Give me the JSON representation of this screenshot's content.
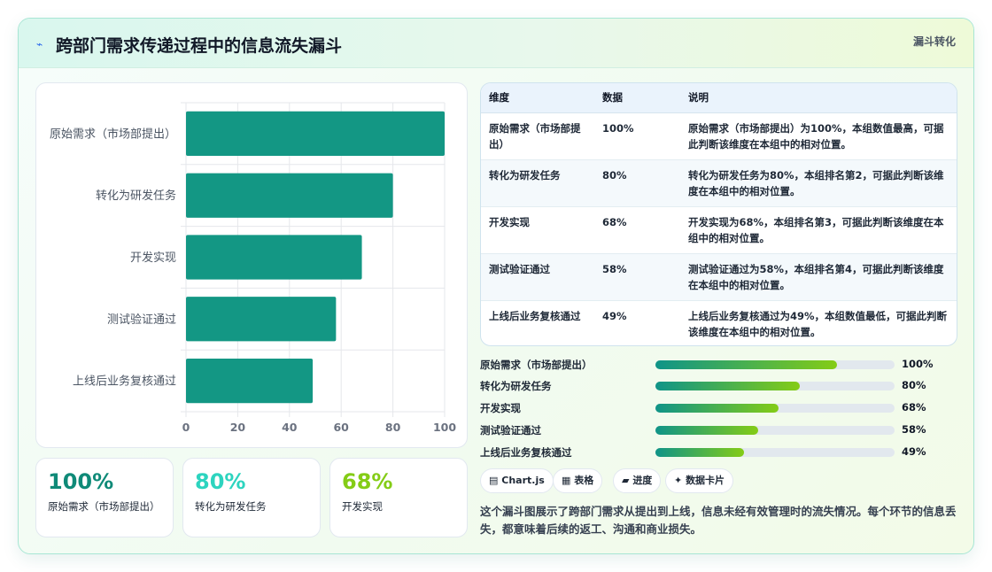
{
  "header": {
    "title": "跨部门需求传递过程中的信息流失漏斗",
    "tag": "漏斗转化"
  },
  "colors": {
    "bar": "#139784",
    "kpi_1": "#0f8a78",
    "kpi_2": "#2dd4bf",
    "kpi_3": "#84cc16",
    "progress_start": "#0f9488",
    "progress_end": "#84cc16"
  },
  "chart_data": {
    "type": "bar",
    "orientation": "horizontal",
    "categories": [
      "原始需求（市场部提出）",
      "转化为研发任务",
      "开发实现",
      "测试验证通过",
      "上线后业务复核通过"
    ],
    "values": [
      100,
      80,
      68,
      58,
      49
    ],
    "xlim": [
      0,
      100
    ],
    "xticks": [
      "0",
      "20",
      "40",
      "60",
      "80",
      "100"
    ],
    "grid": true,
    "legend": "none"
  },
  "kpis": [
    {
      "value": "100%",
      "label": "原始需求（市场部提出）"
    },
    {
      "value": "80%",
      "label": "转化为研发任务"
    },
    {
      "value": "68%",
      "label": "开发实现"
    }
  ],
  "table": {
    "headers": [
      "维度",
      "数据",
      "说明"
    ],
    "rows": [
      {
        "dim": "原始需求（市场部提出）",
        "val": "100%",
        "note": "原始需求（市场部提出）为100%，本组数值最高，可据此判断该维度在本组中的相对位置。"
      },
      {
        "dim": "转化为研发任务",
        "val": "80%",
        "note": "转化为研发任务为80%，本组排名第2，可据此判断该维度在本组中的相对位置。"
      },
      {
        "dim": "开发实现",
        "val": "68%",
        "note": "开发实现为68%，本组排名第3，可据此判断该维度在本组中的相对位置。"
      },
      {
        "dim": "测试验证通过",
        "val": "58%",
        "note": "测试验证通过为58%，本组排名第4，可据此判断该维度在本组中的相对位置。"
      },
      {
        "dim": "上线后业务复核通过",
        "val": "49%",
        "note": "上线后业务复核通过为49%，本组数值最低，可据此判断该维度在本组中的相对位置。"
      }
    ]
  },
  "progress": [
    {
      "label": "原始需求（市场部提出）",
      "value": 100,
      "text": "100%",
      "fill": 0.76
    },
    {
      "label": "转化为研发任务",
      "value": 80,
      "text": "80%",
      "fill": 0.604
    },
    {
      "label": "开发实现",
      "value": 68,
      "text": "68%",
      "fill": 0.515
    },
    {
      "label": "测试验证通过",
      "value": 58,
      "text": "58%",
      "fill": 0.43
    },
    {
      "label": "上线后业务复核通过",
      "value": 49,
      "text": "49%",
      "fill": 0.37
    }
  ],
  "chips": [
    {
      "icon": "▤",
      "label": "Chart.js"
    },
    {
      "icon": "▦",
      "label": "表格"
    },
    {
      "icon": "▰",
      "label": "进度"
    },
    {
      "icon": "✦",
      "label": "数据卡片"
    }
  ],
  "description": "这个漏斗图展示了跨部门需求从提出到上线，信息未经有效管理时的流失情况。每个环节的信息丢失，都意味着后续的返工、沟通和商业损失。"
}
